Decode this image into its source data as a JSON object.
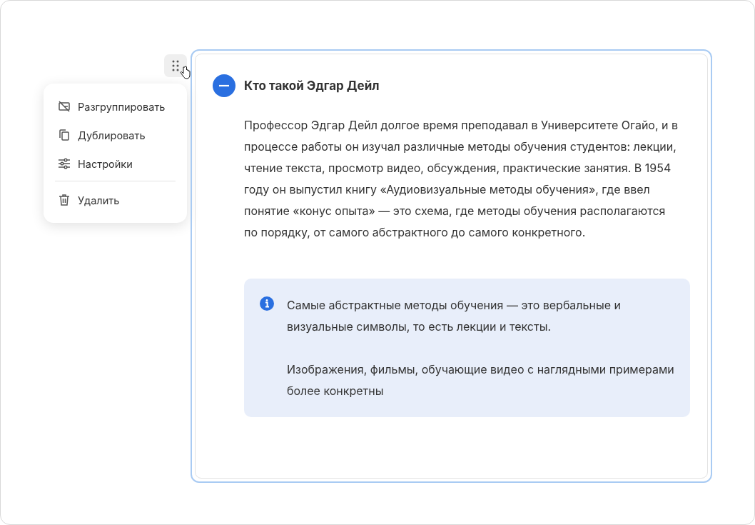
{
  "menu": {
    "groups": [
      {
        "items": [
          {
            "kind": "ungroup",
            "label": "Разгруппировать"
          },
          {
            "kind": "duplicate",
            "label": "Дублировать"
          },
          {
            "kind": "settings",
            "label": "Настройки"
          }
        ]
      },
      {
        "items": [
          {
            "kind": "delete",
            "label": "Удалить"
          }
        ]
      }
    ]
  },
  "section": {
    "title": "Кто такой Эдгар Дейл",
    "expanded": true,
    "paragraph": "Профессор Эдгар Дейл долгое время преподавал в Университете Огайо, и в процессе работы он изучал различные методы обучения студентов: лекции, чтение текста, просмотр видео, обсуждения, практические занятия. В 1954 году он выпустил книгу «Аудиовизуальные методы обучения», где ввел понятие «конус опыта» — это схема, где методы обучения располагаются по порядку, от самого абстрактного до самого конкретного.",
    "callout": {
      "paragraphs": [
        "Самые абстрактные методы обучения — это вербальные и визуальные символы, то есть лекции и тексты.",
        "Изображения, фильмы, обучающие видео с наглядными примерами более конкретны"
      ]
    }
  }
}
